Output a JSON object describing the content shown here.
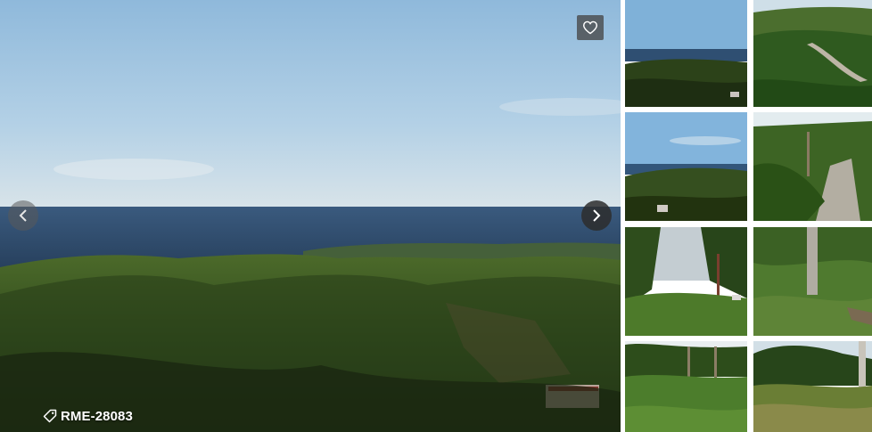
{
  "listing": {
    "reference": "RME-28083"
  },
  "icons": {
    "favorite": "heart-icon",
    "previous": "chevron-left-icon",
    "next": "chevron-right-icon",
    "tag": "tag-icon"
  },
  "colors": {
    "sky": "#9cc3e0",
    "sea": "#2f4a69",
    "forest": "#2f4a1f",
    "overlay_button": "#464646"
  }
}
